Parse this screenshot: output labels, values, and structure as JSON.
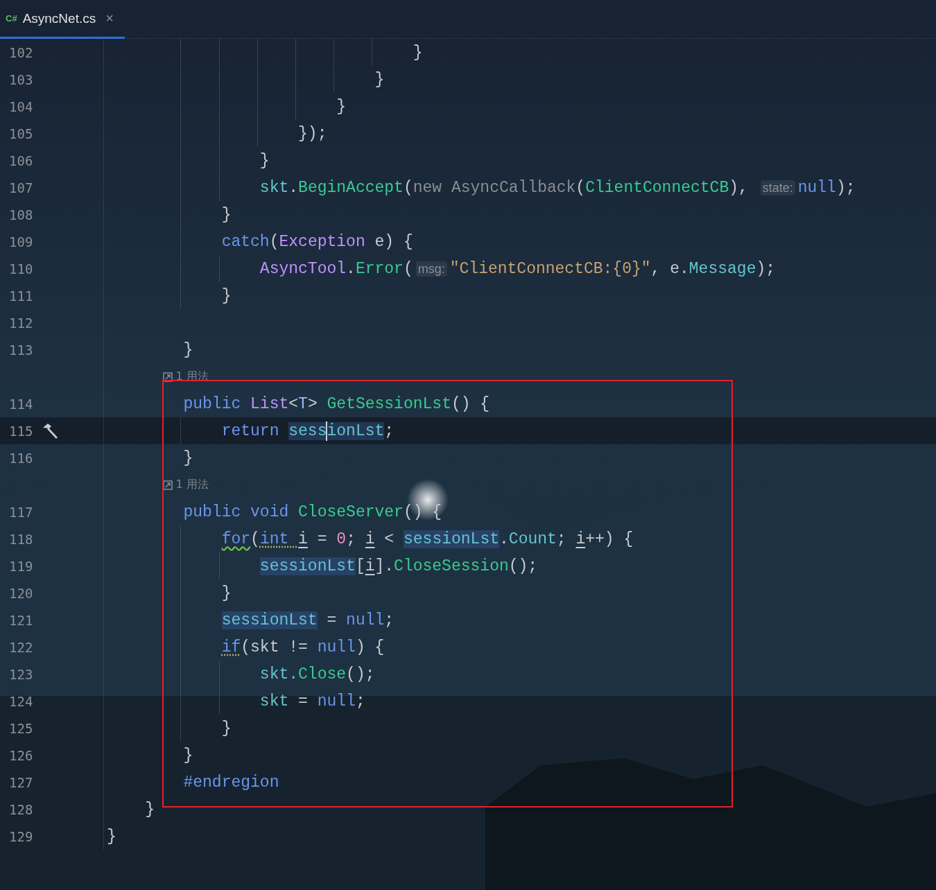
{
  "tabs": [
    {
      "file_type": "C#",
      "title": "AsyncNet.cs",
      "close": "×",
      "selected": true
    }
  ],
  "lines": [
    {
      "kind": "code",
      "number": "102",
      "tokens": [
        {
          "text": "                                }",
          "kind": "p"
        }
      ]
    },
    {
      "kind": "code",
      "number": "103",
      "tokens": [
        {
          "text": "                            }",
          "kind": "p"
        }
      ]
    },
    {
      "kind": "code",
      "number": "104",
      "tokens": [
        {
          "text": "                        }",
          "kind": "p"
        }
      ]
    },
    {
      "kind": "code",
      "number": "105",
      "tokens": [
        {
          "text": "                    });",
          "kind": "p"
        }
      ]
    },
    {
      "kind": "code",
      "number": "106",
      "tokens": [
        {
          "text": "                }",
          "kind": "p"
        }
      ]
    },
    {
      "kind": "code",
      "number": "107",
      "tokens": [
        {
          "text": "                skt",
          "kind": "v"
        },
        {
          "text": ".",
          "kind": "p"
        },
        {
          "text": "BeginAccept",
          "kind": "f"
        },
        {
          "text": "(",
          "kind": "p"
        },
        {
          "text": "new AsyncCallback",
          "kind": "d"
        },
        {
          "text": "(",
          "kind": "p"
        },
        {
          "text": "ClientConnectCB",
          "kind": "f"
        },
        {
          "text": "), ",
          "kind": "p"
        },
        {
          "text": "state:",
          "kind": "h"
        },
        {
          "text": "null",
          "kind": "k"
        },
        {
          "text": ");",
          "kind": "p"
        }
      ]
    },
    {
      "kind": "code",
      "number": "108",
      "tokens": [
        {
          "text": "            }",
          "kind": "p"
        }
      ]
    },
    {
      "kind": "code",
      "number": "109",
      "tokens": [
        {
          "text": "            catch",
          "kind": "k"
        },
        {
          "text": "(",
          "kind": "p"
        },
        {
          "text": "Exception",
          "kind": "t"
        },
        {
          "text": " e) {",
          "kind": "p"
        }
      ]
    },
    {
      "kind": "code",
      "number": "110",
      "tokens": [
        {
          "text": "                AsyncTool",
          "kind": "t"
        },
        {
          "text": ".",
          "kind": "p"
        },
        {
          "text": "Error",
          "kind": "f"
        },
        {
          "text": "(",
          "kind": "p"
        },
        {
          "text": "msg:",
          "kind": "h"
        },
        {
          "text": "\"ClientConnectCB:{0}\"",
          "kind": "s"
        },
        {
          "text": ", e.",
          "kind": "p"
        },
        {
          "text": "Message",
          "kind": "v"
        },
        {
          "text": ");",
          "kind": "p"
        }
      ]
    },
    {
      "kind": "code",
      "number": "111",
      "tokens": [
        {
          "text": "            }",
          "kind": "p"
        }
      ]
    },
    {
      "kind": "code",
      "number": "112"
    },
    {
      "kind": "code",
      "number": "113",
      "tokens": [
        {
          "text": "        }",
          "kind": "p"
        }
      ]
    },
    {
      "kind": "usage",
      "text": "1 用法"
    },
    {
      "kind": "code",
      "number": "114",
      "tokens": [
        {
          "text": "        public ",
          "kind": "k"
        },
        {
          "text": "List",
          "kind": "t"
        },
        {
          "text": "<",
          "kind": "p"
        },
        {
          "text": "T",
          "kind": "g"
        },
        {
          "text": "> ",
          "kind": "p"
        },
        {
          "text": "GetSessionLst",
          "kind": "f"
        },
        {
          "text": "() {",
          "kind": "p"
        }
      ]
    },
    {
      "kind": "code",
      "number": "115",
      "current": true,
      "build_marker": true,
      "tokens": [
        {
          "text": "            return ",
          "kind": "k"
        },
        {
          "text": "sess",
          "kind": "v",
          "highlighted": true,
          "caret_after": true
        },
        {
          "text": "ionLst",
          "kind": "v",
          "highlighted": true
        },
        {
          "text": ";",
          "kind": "p"
        }
      ]
    },
    {
      "kind": "code",
      "number": "116",
      "tokens": [
        {
          "text": "        }",
          "kind": "p"
        }
      ]
    },
    {
      "kind": "usage",
      "text": "1 用法"
    },
    {
      "kind": "code",
      "number": "117",
      "tokens": [
        {
          "text": "        public void ",
          "kind": "k"
        },
        {
          "text": "CloseServer",
          "kind": "f"
        },
        {
          "text": "() {",
          "kind": "p"
        }
      ]
    },
    {
      "kind": "code",
      "number": "118",
      "tokens": [
        {
          "text": "            for",
          "kind": "k",
          "squiggle": true
        },
        {
          "text": "(",
          "kind": "p"
        },
        {
          "text": "int ",
          "kind": "k",
          "dotted": true
        },
        {
          "text": "i",
          "kind": "p",
          "underlined": true
        },
        {
          "text": " = ",
          "kind": "p"
        },
        {
          "text": "0",
          "kind": "n"
        },
        {
          "text": "; ",
          "kind": "p"
        },
        {
          "text": "i",
          "kind": "p",
          "underlined": true
        },
        {
          "text": " < ",
          "kind": "p"
        },
        {
          "text": "sessionLst",
          "kind": "v",
          "highlighted": true
        },
        {
          "text": ".",
          "kind": "p"
        },
        {
          "text": "Count",
          "kind": "v"
        },
        {
          "text": "; ",
          "kind": "p"
        },
        {
          "text": "i",
          "kind": "p",
          "underlined": true
        },
        {
          "text": "++) {",
          "kind": "p"
        }
      ]
    },
    {
      "kind": "code",
      "number": "119",
      "tokens": [
        {
          "text": "                sessionLst",
          "kind": "v",
          "highlighted": true
        },
        {
          "text": "[",
          "kind": "p"
        },
        {
          "text": "i",
          "kind": "p",
          "underlined": true
        },
        {
          "text": "].",
          "kind": "p"
        },
        {
          "text": "CloseSession",
          "kind": "f"
        },
        {
          "text": "();",
          "kind": "p"
        }
      ]
    },
    {
      "kind": "code",
      "number": "120",
      "tokens": [
        {
          "text": "            }",
          "kind": "p"
        }
      ]
    },
    {
      "kind": "code",
      "number": "121",
      "tokens": [
        {
          "text": "            sessionLst",
          "kind": "v",
          "highlighted": true
        },
        {
          "text": " = ",
          "kind": "p"
        },
        {
          "text": "null",
          "kind": "k"
        },
        {
          "text": ";",
          "kind": "p"
        }
      ]
    },
    {
      "kind": "code",
      "number": "122",
      "tokens": [
        {
          "text": "            if",
          "kind": "k",
          "dotted": true
        },
        {
          "text": "(skt != ",
          "kind": "p"
        },
        {
          "text": "null",
          "kind": "k"
        },
        {
          "text": ") {",
          "kind": "p"
        }
      ]
    },
    {
      "kind": "code",
      "number": "123",
      "tokens": [
        {
          "text": "                skt.",
          "kind": "v"
        },
        {
          "text": "Close",
          "kind": "f"
        },
        {
          "text": "();",
          "kind": "p"
        }
      ]
    },
    {
      "kind": "code",
      "number": "124",
      "tokens": [
        {
          "text": "                skt",
          "kind": "v"
        },
        {
          "text": " = ",
          "kind": "p"
        },
        {
          "text": "null",
          "kind": "k"
        },
        {
          "text": ";",
          "kind": "p"
        }
      ]
    },
    {
      "kind": "code",
      "number": "125",
      "tokens": [
        {
          "text": "            }",
          "kind": "p"
        }
      ]
    },
    {
      "kind": "code",
      "number": "126",
      "tokens": [
        {
          "text": "        }",
          "kind": "p"
        }
      ]
    },
    {
      "kind": "code",
      "number": "127",
      "tokens": [
        {
          "text": "        #endregion",
          "kind": "k"
        }
      ]
    },
    {
      "kind": "code",
      "number": "128",
      "tokens": [
        {
          "text": "    }",
          "kind": "p"
        }
      ]
    },
    {
      "kind": "code",
      "number": "129",
      "tokens": [
        {
          "text": "}",
          "kind": "p"
        }
      ]
    }
  ]
}
